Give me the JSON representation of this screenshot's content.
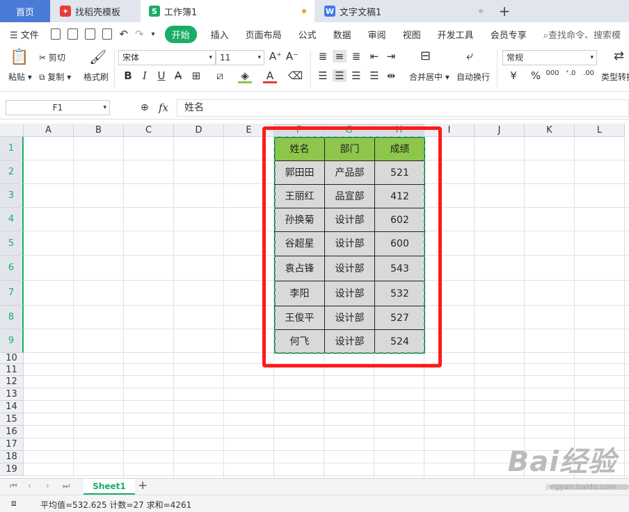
{
  "tabs": [
    {
      "label": "首页",
      "icon": "home-tab"
    },
    {
      "label": "找稻壳模板",
      "icon": "docer-icon"
    },
    {
      "label": "工作簿1",
      "icon": "spreadsheet-icon"
    },
    {
      "label": "文字文稿1",
      "icon": "word-icon"
    }
  ],
  "new_tab": "+",
  "menu": {
    "file": "文件",
    "items": [
      "开始",
      "插入",
      "页面布局",
      "公式",
      "数据",
      "审阅",
      "视图",
      "开发工具",
      "会员专享"
    ],
    "search": "查找命令、搜索模"
  },
  "ribbon": {
    "paste": "粘贴",
    "cut": "剪切",
    "copy": "复制",
    "format_painter": "格式刷",
    "font": "宋体",
    "size": "11",
    "bold": "B",
    "italic": "I",
    "underline": "U",
    "merge": "合并居中",
    "wrap": "自动换行",
    "number_format": "常规",
    "currency": "¥",
    "percent": "%",
    "thousands": "000",
    "type_convert": "类型转换"
  },
  "formula_bar": {
    "cell_ref": "F1",
    "fx": "fx",
    "content": "姓名"
  },
  "columns": [
    "A",
    "B",
    "C",
    "D",
    "E",
    "F",
    "G",
    "H",
    "I",
    "J",
    "K",
    "L"
  ],
  "rows": [
    "1",
    "2",
    "3",
    "4",
    "5",
    "6",
    "7",
    "8",
    "9",
    "10",
    "11",
    "12",
    "13",
    "14",
    "15",
    "16",
    "17",
    "18",
    "19"
  ],
  "table": {
    "headers": [
      "姓名",
      "部门",
      "成绩"
    ],
    "rows": [
      [
        "郭田田",
        "产品部",
        "521"
      ],
      [
        "王丽红",
        "品宣部",
        "412"
      ],
      [
        "孙换菊",
        "设计部",
        "602"
      ],
      [
        "谷超星",
        "设计部",
        "600"
      ],
      [
        "袁占锋",
        "设计部",
        "543"
      ],
      [
        "李阳",
        "设计部",
        "532"
      ],
      [
        "王俊平",
        "设计部",
        "527"
      ],
      [
        "何飞",
        "设计部",
        "524"
      ]
    ]
  },
  "sheet_tab": "Sheet1",
  "status": "平均值=532.625  计数=27  求和=4261",
  "watermark": "Bai经验",
  "watermark_url": "jingyan.baidu.com",
  "colors": {
    "accent": "#1aad66",
    "header_fill": "#8dc64b",
    "body_fill": "#d9d9d9",
    "selection": "#ff1a1a"
  }
}
